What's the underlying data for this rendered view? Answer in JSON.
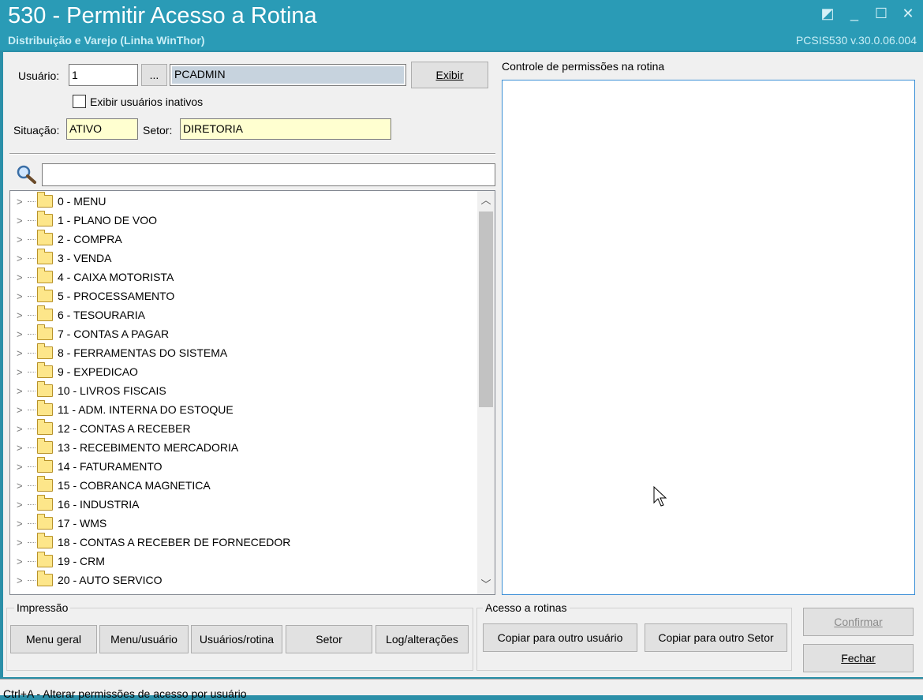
{
  "window": {
    "title": "530 - Permitir Acesso a Rotina",
    "subtitle": "Distribuição e Varejo (Linha WinThor)",
    "version": "PCSIS530  v.30.0.06.004"
  },
  "user": {
    "label": "Usuário:",
    "id_value": "1",
    "browse_label": "...",
    "name_value": "PCADMIN",
    "show_button": "Exibir",
    "show_inactive_label": "Exibir usuários inativos",
    "show_inactive_checked": false,
    "situation_label": "Situação:",
    "situation_value": "ATIVO",
    "sector_label": "Setor:",
    "sector_value": "DIRETORIA"
  },
  "search": {
    "value": ""
  },
  "tree": {
    "items": [
      "0 - MENU",
      "1 - PLANO DE VOO",
      "2 - COMPRA",
      "3 - VENDA",
      "4 - CAIXA MOTORISTA",
      "5 - PROCESSAMENTO",
      "6 - TESOURARIA",
      "7 - CONTAS A PAGAR",
      "8 - FERRAMENTAS DO SISTEMA",
      "9 - EXPEDICAO",
      "10 - LIVROS FISCAIS",
      "11 - ADM. INTERNA DO ESTOQUE",
      "12 - CONTAS A RECEBER",
      "13 - RECEBIMENTO MERCADORIA",
      "14 - FATURAMENTO",
      "15 - COBRANCA MAGNETICA",
      "16 - INDUSTRIA",
      "17 - WMS",
      "18 - CONTAS A RECEBER DE FORNECEDOR",
      "19 - CRM",
      "20 - AUTO SERVICO"
    ]
  },
  "permissions": {
    "label": "Controle de permissões na rotina"
  },
  "printing": {
    "title": "Impressão",
    "buttons": [
      "Menu geral",
      "Menu/usuário",
      "Usuários/rotina",
      "Setor",
      "Log/alterações"
    ]
  },
  "access": {
    "title": "Acesso a rotinas",
    "copy_user": "Copiar para outro usuário",
    "copy_sector": "Copiar para outro Setor"
  },
  "actions": {
    "confirm": "Confirmar",
    "close": "Fechar"
  },
  "status": {
    "text": "Ctrl+A - Alterar permissões de acesso por usuário"
  }
}
